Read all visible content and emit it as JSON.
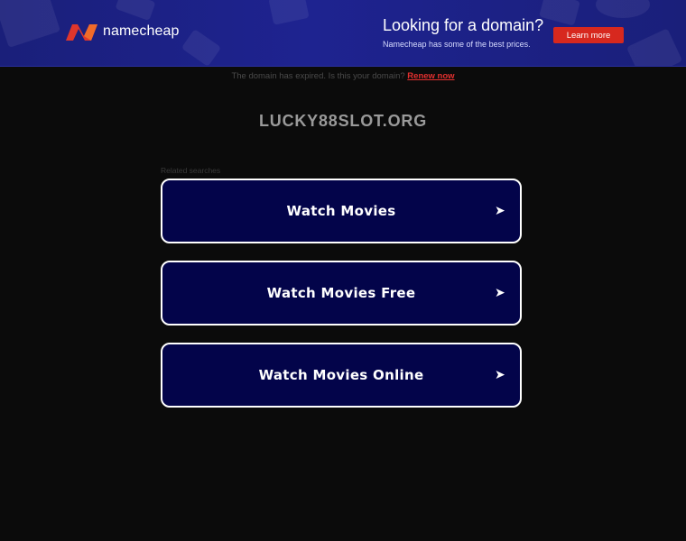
{
  "banner": {
    "brand": "namecheap",
    "promo_title": "Looking for a domain?",
    "promo_subtitle": "Namecheap has some of the best prices.",
    "cta_label": "Learn more",
    "colors": {
      "background": "#1e2390",
      "cta": "#d7281e",
      "logo_accent": "#e0362c"
    }
  },
  "notice": {
    "text": "The domain has expired. Is this your domain?",
    "link_label": "Renew now"
  },
  "domain_name": "LUCKY88SLOT.ORG",
  "related": {
    "label": "Related searches",
    "items": [
      {
        "label": "Watch Movies",
        "icon": "arrow-right-icon"
      },
      {
        "label": "Watch Movies Free",
        "icon": "arrow-right-icon"
      },
      {
        "label": "Watch Movies Online",
        "icon": "arrow-right-icon"
      }
    ]
  },
  "colors": {
    "page_background": "#0b0b0b",
    "item_background": "#03044a",
    "item_border": "#ffffff",
    "renew_link": "#e3302f"
  }
}
